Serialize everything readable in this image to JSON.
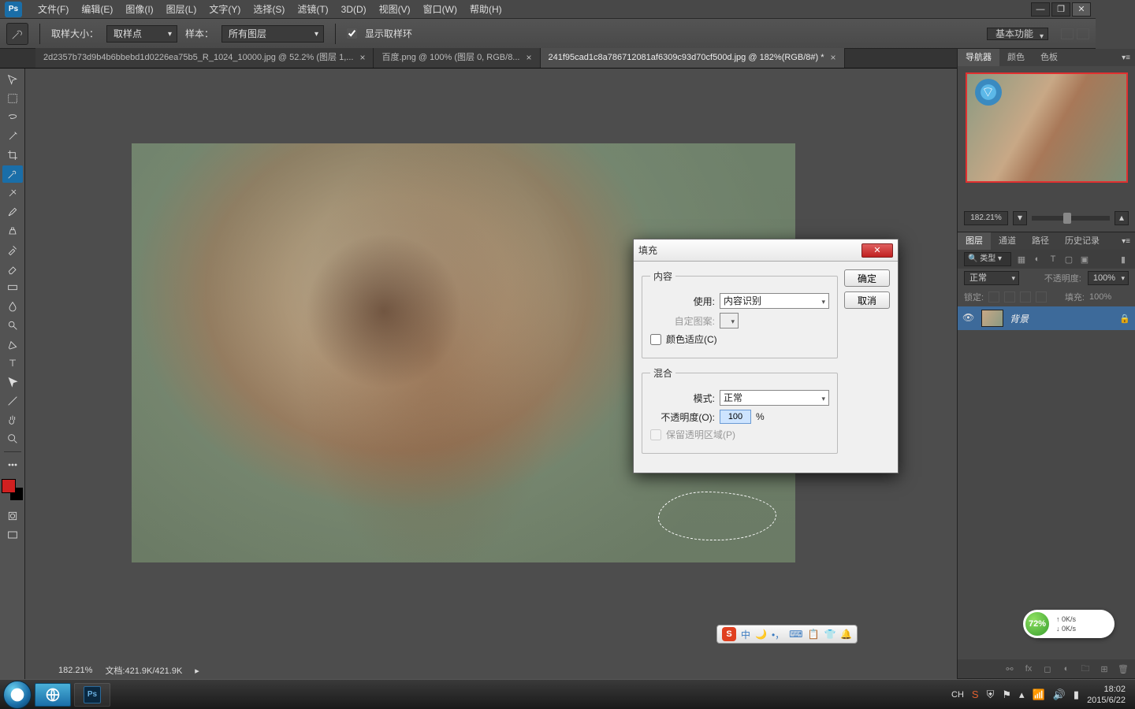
{
  "menubar": {
    "items": [
      "文件(F)",
      "编辑(E)",
      "图像(I)",
      "图层(L)",
      "文字(Y)",
      "选择(S)",
      "滤镜(T)",
      "3D(D)",
      "视图(V)",
      "窗口(W)",
      "帮助(H)"
    ]
  },
  "optionsbar": {
    "sample_size_label": "取样大小：",
    "sample_size_value": "取样点",
    "sample_label": "样本：",
    "sample_value": "所有图层",
    "show_ring_label": "显示取样环",
    "workspace_btn": "基本功能"
  },
  "tabs": [
    {
      "label": "2d2357b73d9b4b6bbebd1d0226ea75b5_R_1024_10000.jpg @ 52.2% (图层 1,...",
      "active": false
    },
    {
      "label": "百度.png @ 100% (图层 0, RGB/8...",
      "active": false
    },
    {
      "label": "241f95cad1c8a786712081af6309c93d70cf500d.jpg @ 182%(RGB/8#) *",
      "active": true
    }
  ],
  "statusbar": {
    "zoom": "182.21%",
    "docinfo": "文档:421.9K/421.9K"
  },
  "navigator": {
    "tabs": [
      "导航器",
      "颜色",
      "色板"
    ],
    "zoom": "182.21%"
  },
  "layerspanel": {
    "tabs": [
      "图层",
      "通道",
      "路径",
      "历史记录"
    ],
    "kind_label": "类型",
    "blend_mode": "正常",
    "opacity_label": "不透明度:",
    "opacity_value": "100%",
    "lock_label": "锁定:",
    "fill_label": "填充:",
    "fill_value": "100%",
    "layers": [
      {
        "name": "背景",
        "locked": true
      }
    ]
  },
  "dialog": {
    "title": "填充",
    "ok": "确定",
    "cancel": "取消",
    "content_group": "内容",
    "use_label": "使用:",
    "use_value": "内容识别",
    "custom_pattern_label": "自定图案:",
    "color_adapt_label": "颜色适应(C)",
    "blend_group": "混合",
    "mode_label": "模式:",
    "mode_value": "正常",
    "opacity_label": "不透明度(O):",
    "opacity_value": "100",
    "opacity_unit": "%",
    "preserve_trans_label": "保留透明区域(P)"
  },
  "taskbar": {
    "time": "18:02",
    "date": "2015/6/22",
    "ime_lang": "CH"
  },
  "speed_widget": {
    "percent": "72%",
    "up": "0K/s",
    "down": "0K/s"
  },
  "ime_bar": {
    "items": [
      "中",
      "🌙",
      "•，",
      "⌨",
      "📋",
      "👕",
      "🔔"
    ]
  }
}
